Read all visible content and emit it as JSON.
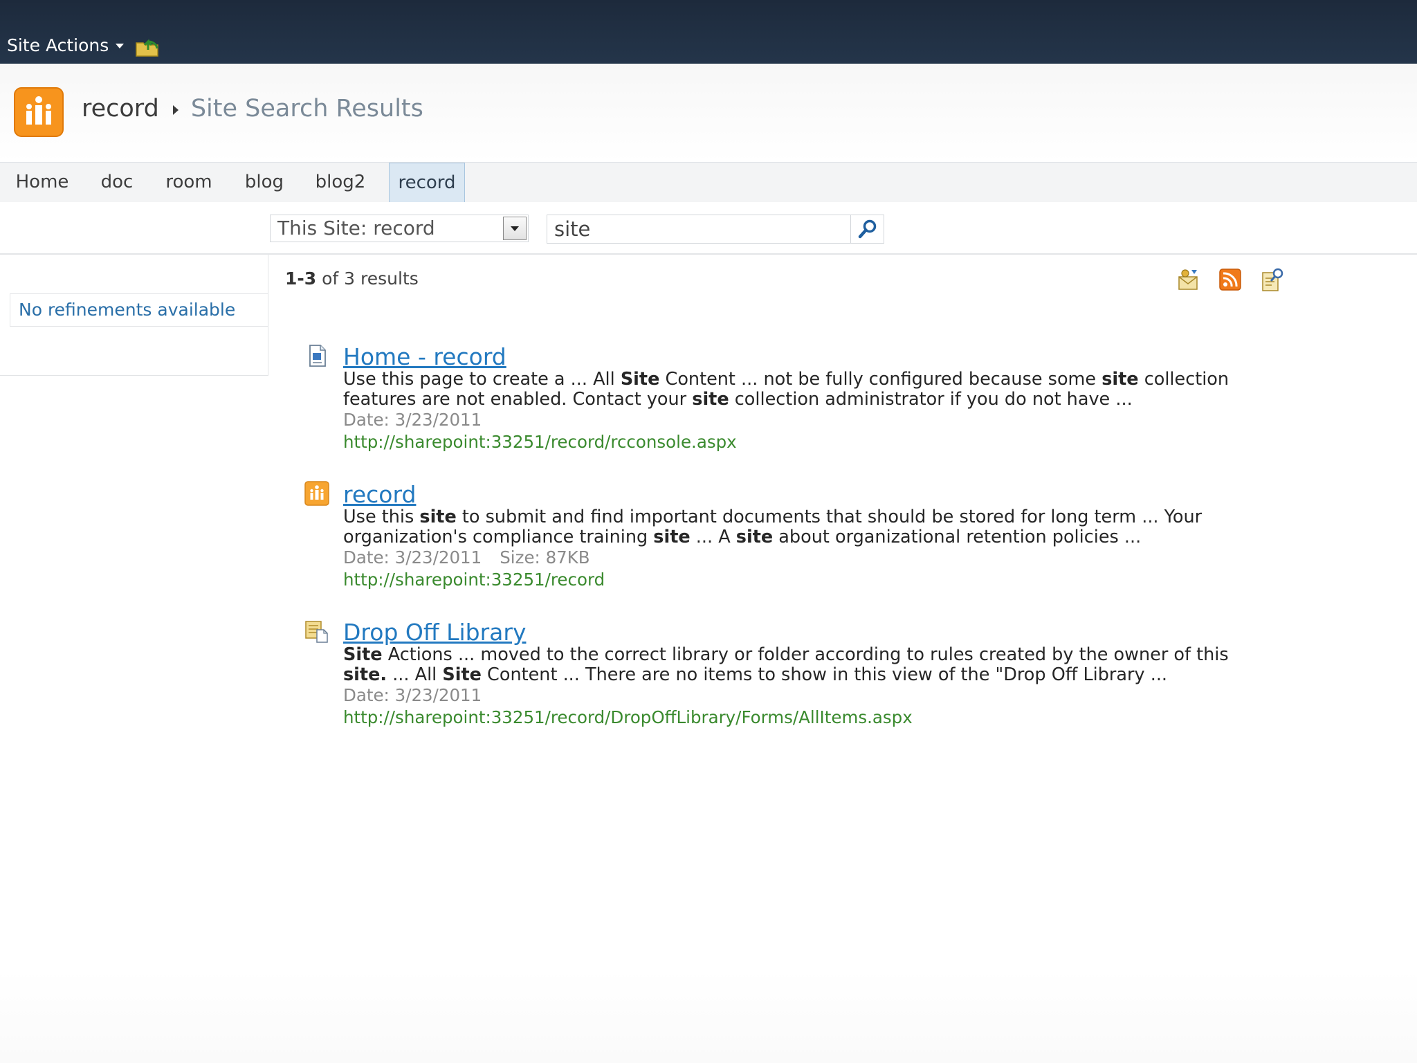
{
  "ribbon": {
    "site_actions_label": "Site Actions"
  },
  "titlearea": {
    "site_name": "record",
    "page_title": "Site Search Results"
  },
  "topnav": {
    "tabs": [
      {
        "label": "Home"
      },
      {
        "label": "doc"
      },
      {
        "label": "room"
      },
      {
        "label": "blog"
      },
      {
        "label": "blog2"
      },
      {
        "label": "record",
        "selected": true
      }
    ]
  },
  "search": {
    "scope": "This Site: record",
    "query": "site"
  },
  "refinement": {
    "message": "No refinements available"
  },
  "results_summary": {
    "range": "1-3",
    "of_text": " of 3 results"
  },
  "results": [
    {
      "title": "Home - record",
      "icon": "page-icon",
      "snippet_parts": [
        {
          "t": "Use this page to create a ... All "
        },
        {
          "t": "Site",
          "b": true
        },
        {
          "t": " Content ... not be fully configured because some "
        },
        {
          "t": "site",
          "b": true
        },
        {
          "t": " collection features are not enabled. Contact your "
        },
        {
          "t": "site",
          "b": true
        },
        {
          "t": " collection administrator if you do not have ..."
        }
      ],
      "date": "Date: 3/23/2011",
      "size": "",
      "url": "http://sharepoint:33251/record/rcconsole.aspx"
    },
    {
      "title": "record",
      "icon": "site-icon",
      "snippet_parts": [
        {
          "t": "Use this "
        },
        {
          "t": "site",
          "b": true
        },
        {
          "t": " to submit and find important documents that should be stored for long term ... Your organization's compliance training "
        },
        {
          "t": "site",
          "b": true
        },
        {
          "t": " ... A "
        },
        {
          "t": "site",
          "b": true
        },
        {
          "t": " about organizational retention policies ..."
        }
      ],
      "date": "Date: 3/23/2011",
      "size": "Size: 87KB",
      "url": "http://sharepoint:33251/record"
    },
    {
      "title": "Drop Off Library",
      "icon": "library-icon",
      "snippet_parts": [
        {
          "t": "Site",
          "b": true
        },
        {
          "t": " Actions ... moved to the correct library or folder according to rules created by the owner of this "
        },
        {
          "t": "site.",
          "b": true
        },
        {
          "t": " ... All "
        },
        {
          "t": "Site",
          "b": true
        },
        {
          "t": " Content ... There are no items to show in this view of the \"Drop Off Library ..."
        }
      ],
      "date": "Date: 3/23/2011",
      "size": "",
      "url": "http://sharepoint:33251/record/DropOffLibrary/Forms/AllItems.aspx"
    }
  ],
  "colors": {
    "ribbon": "#1d2a3c",
    "link": "#2279c0",
    "url": "#3a8a2e",
    "accent_orange": "#f7941d"
  }
}
